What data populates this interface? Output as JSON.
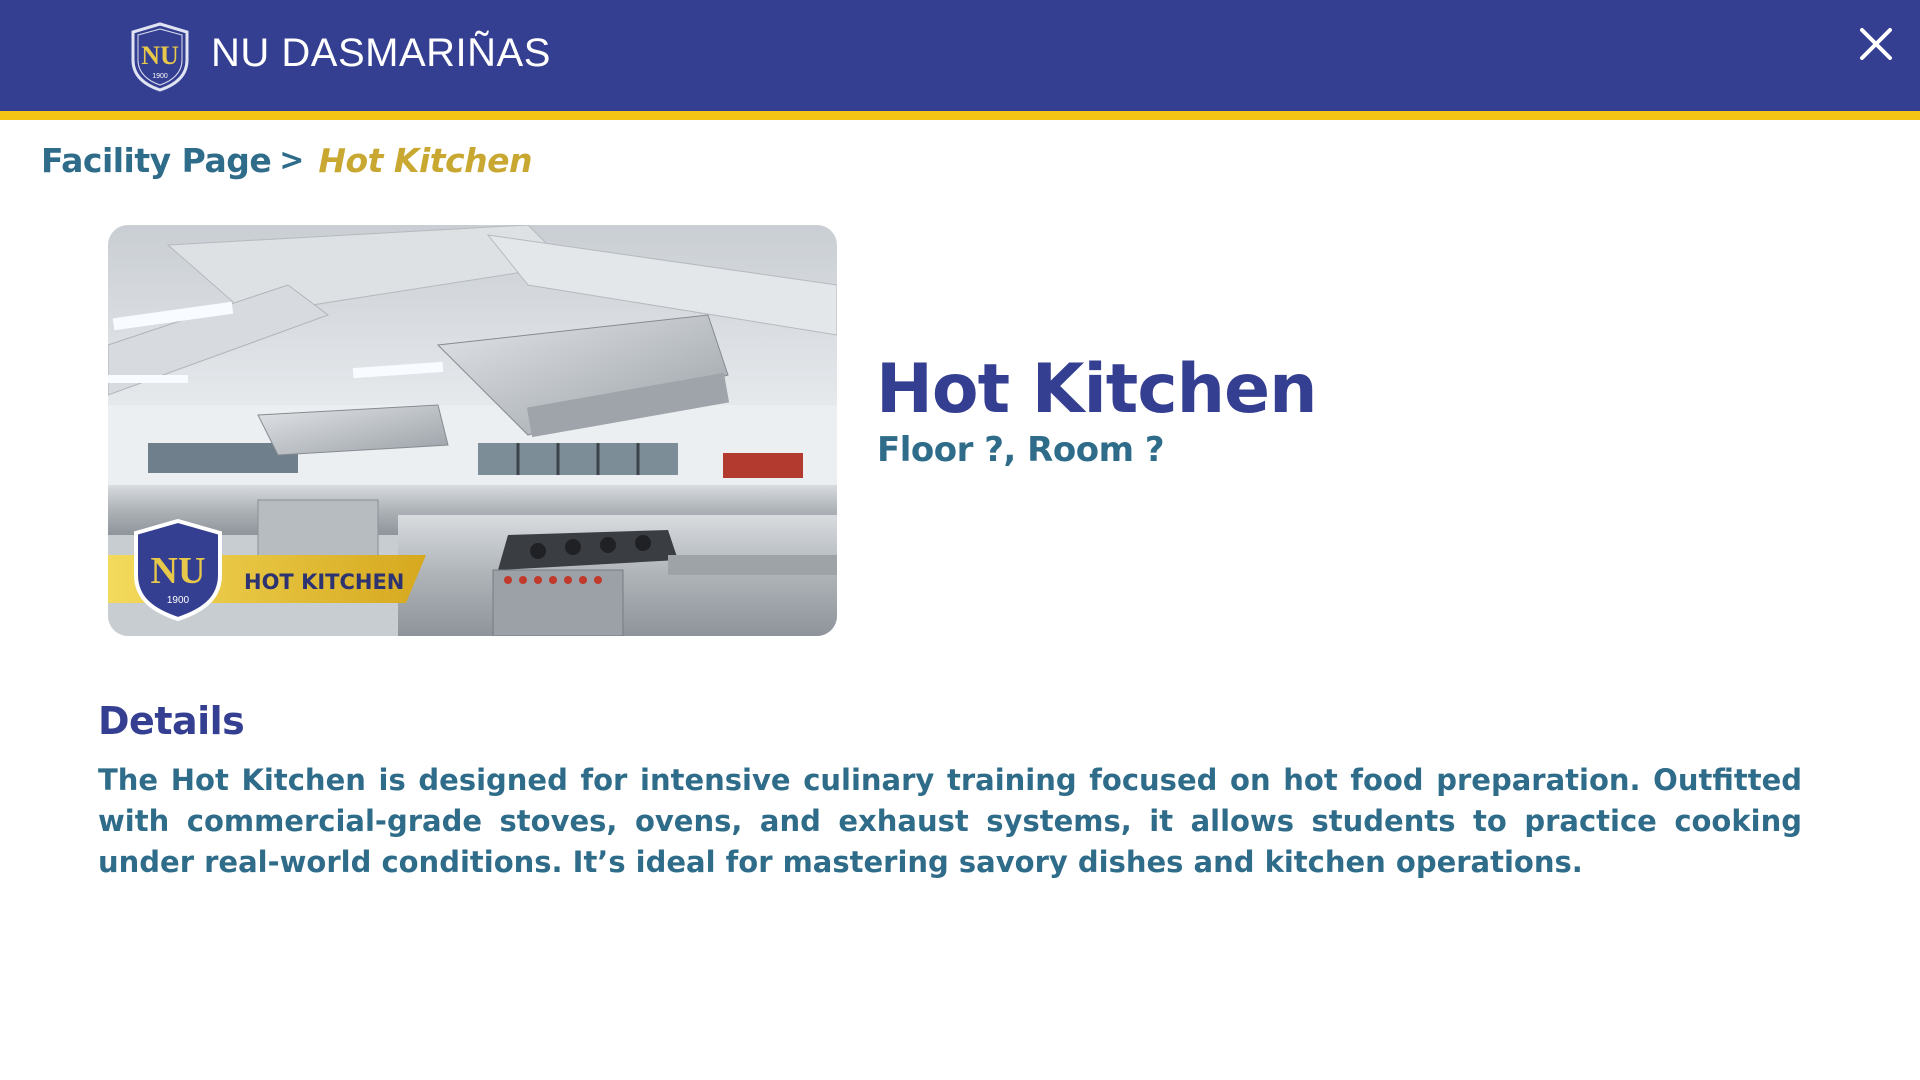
{
  "header": {
    "brand": "NU DASMARIÑAS",
    "logo_year": "1900",
    "close_icon": "close-icon",
    "colors": {
      "bar": "#353f91",
      "stripe": "#f4c515"
    }
  },
  "breadcrumb": {
    "parent": "Facility Page",
    "separator": ">",
    "current": "Hot Kitchen"
  },
  "facility": {
    "image_caption": "HOT KITCHEN",
    "image_logo_year": "1900",
    "title": "Hot Kitchen",
    "location": "Floor ?, Room ?"
  },
  "details": {
    "heading": "Details",
    "text": "The Hot Kitchen is designed for intensive culinary training focused on hot food preparation. Outfitted with commercial-grade stoves, ovens, and exhaust systems, it allows students to practice cooking under real-world conditions. It’s ideal for mastering savory dishes and kitchen operations."
  }
}
